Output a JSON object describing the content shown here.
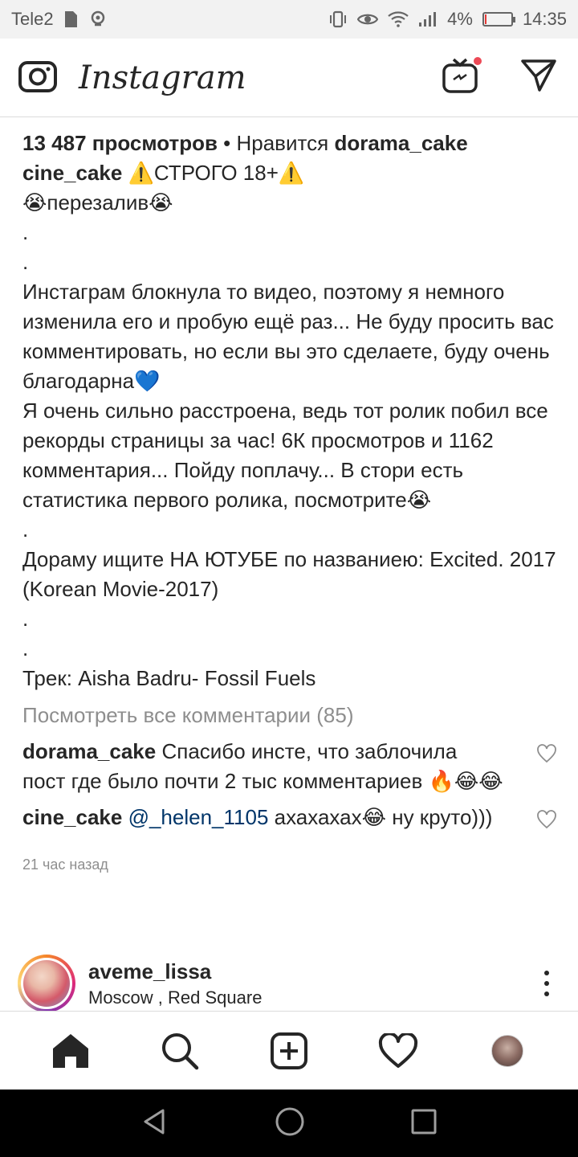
{
  "status_bar": {
    "carrier": "Tele2",
    "battery_percent": "4%",
    "battery_level": 0.04,
    "time": "14:35"
  },
  "app": {
    "title": "Instagram"
  },
  "post": {
    "views_count": "13 487 просмотров",
    "liked_by_prefix": " • Нравится ",
    "liked_by_user": "dorama_cake",
    "author": "cine_cake",
    "caption_lines": [
      "⚠️СТРОГО 18+⚠️",
      "😭перезалив😭",
      ".",
      ".",
      "Инстаграм блокнула то видео, поэтому я немного изменила его и пробую ещё раз... Не буду просить вас комментировать, но если вы это сделаете, буду очень благодарна💙",
      "Я очень сильно расстроена, ведь тот ролик побил все рекорды страницы за час! 6К просмотров и 1162 комментария... Пойду поплачу... В стори есть статистика первого ролика, посмотрите😭",
      ".",
      "Дораму ищите НА ЮТУБЕ по названиею: Excited. 2017 (Korean Movie-2017)",
      ".",
      ".",
      "Трек: Aisha Badru- Fossil Fuels"
    ],
    "view_all_comments": "Посмотреть все комментарии (85)",
    "comments": [
      {
        "user": "dorama_cake",
        "mention": "",
        "text": "Спасибо инсте, что заблочила пост где было почти 2 тыс комментариев 🔥😂😂"
      },
      {
        "user": "cine_cake",
        "mention": "@_helen_1105",
        "text": "ахахахах😂 ну круто)))"
      }
    ],
    "timestamp": "21 час назад"
  },
  "next_post": {
    "username": "aveme_lissa",
    "location": "Moscow , Red Square"
  },
  "colors": {
    "text": "#262626",
    "secondary": "#8e8e8e",
    "mention": "#003569",
    "notification_dot": "#ed4956"
  }
}
